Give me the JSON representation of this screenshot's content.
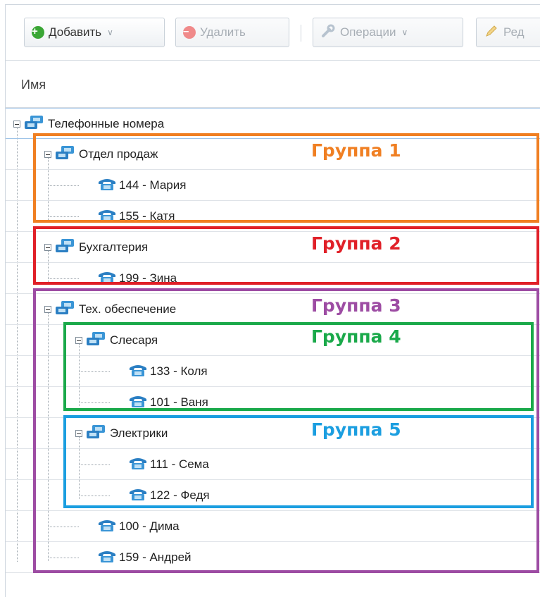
{
  "toolbar": {
    "add_label": "Добавить",
    "delete_label": "Удалить",
    "operations_label": "Операции",
    "edit_label": "Ред"
  },
  "header": {
    "name_col": "Имя"
  },
  "tree": {
    "root": "Телефонные номера",
    "sales": "Отдел продаж",
    "maria": "144 - Мария",
    "katya": "155 - Катя",
    "accounting": "Бухгалтерия",
    "zina": "199 - Зина",
    "tech": "Тех. обеспечение",
    "locksmiths": "Слесаря",
    "kolya": "133 - Коля",
    "vanya": "101 - Ваня",
    "electricians": "Электрики",
    "sema": "111 - Сема",
    "fedya": "122 - Федя",
    "dima": "100 - Дима",
    "andrey": "159 - Андрей"
  },
  "annotations": {
    "group1": "Группа 1",
    "group2": "Группа 2",
    "group3": "Группа 3",
    "group4": "Группа 4",
    "group5": "Группа 5"
  },
  "colors": {
    "group1": "#f07f22",
    "group2": "#e02028",
    "group3": "#9d4ca3",
    "group4": "#1aa94a",
    "group5": "#1b9ee0"
  }
}
